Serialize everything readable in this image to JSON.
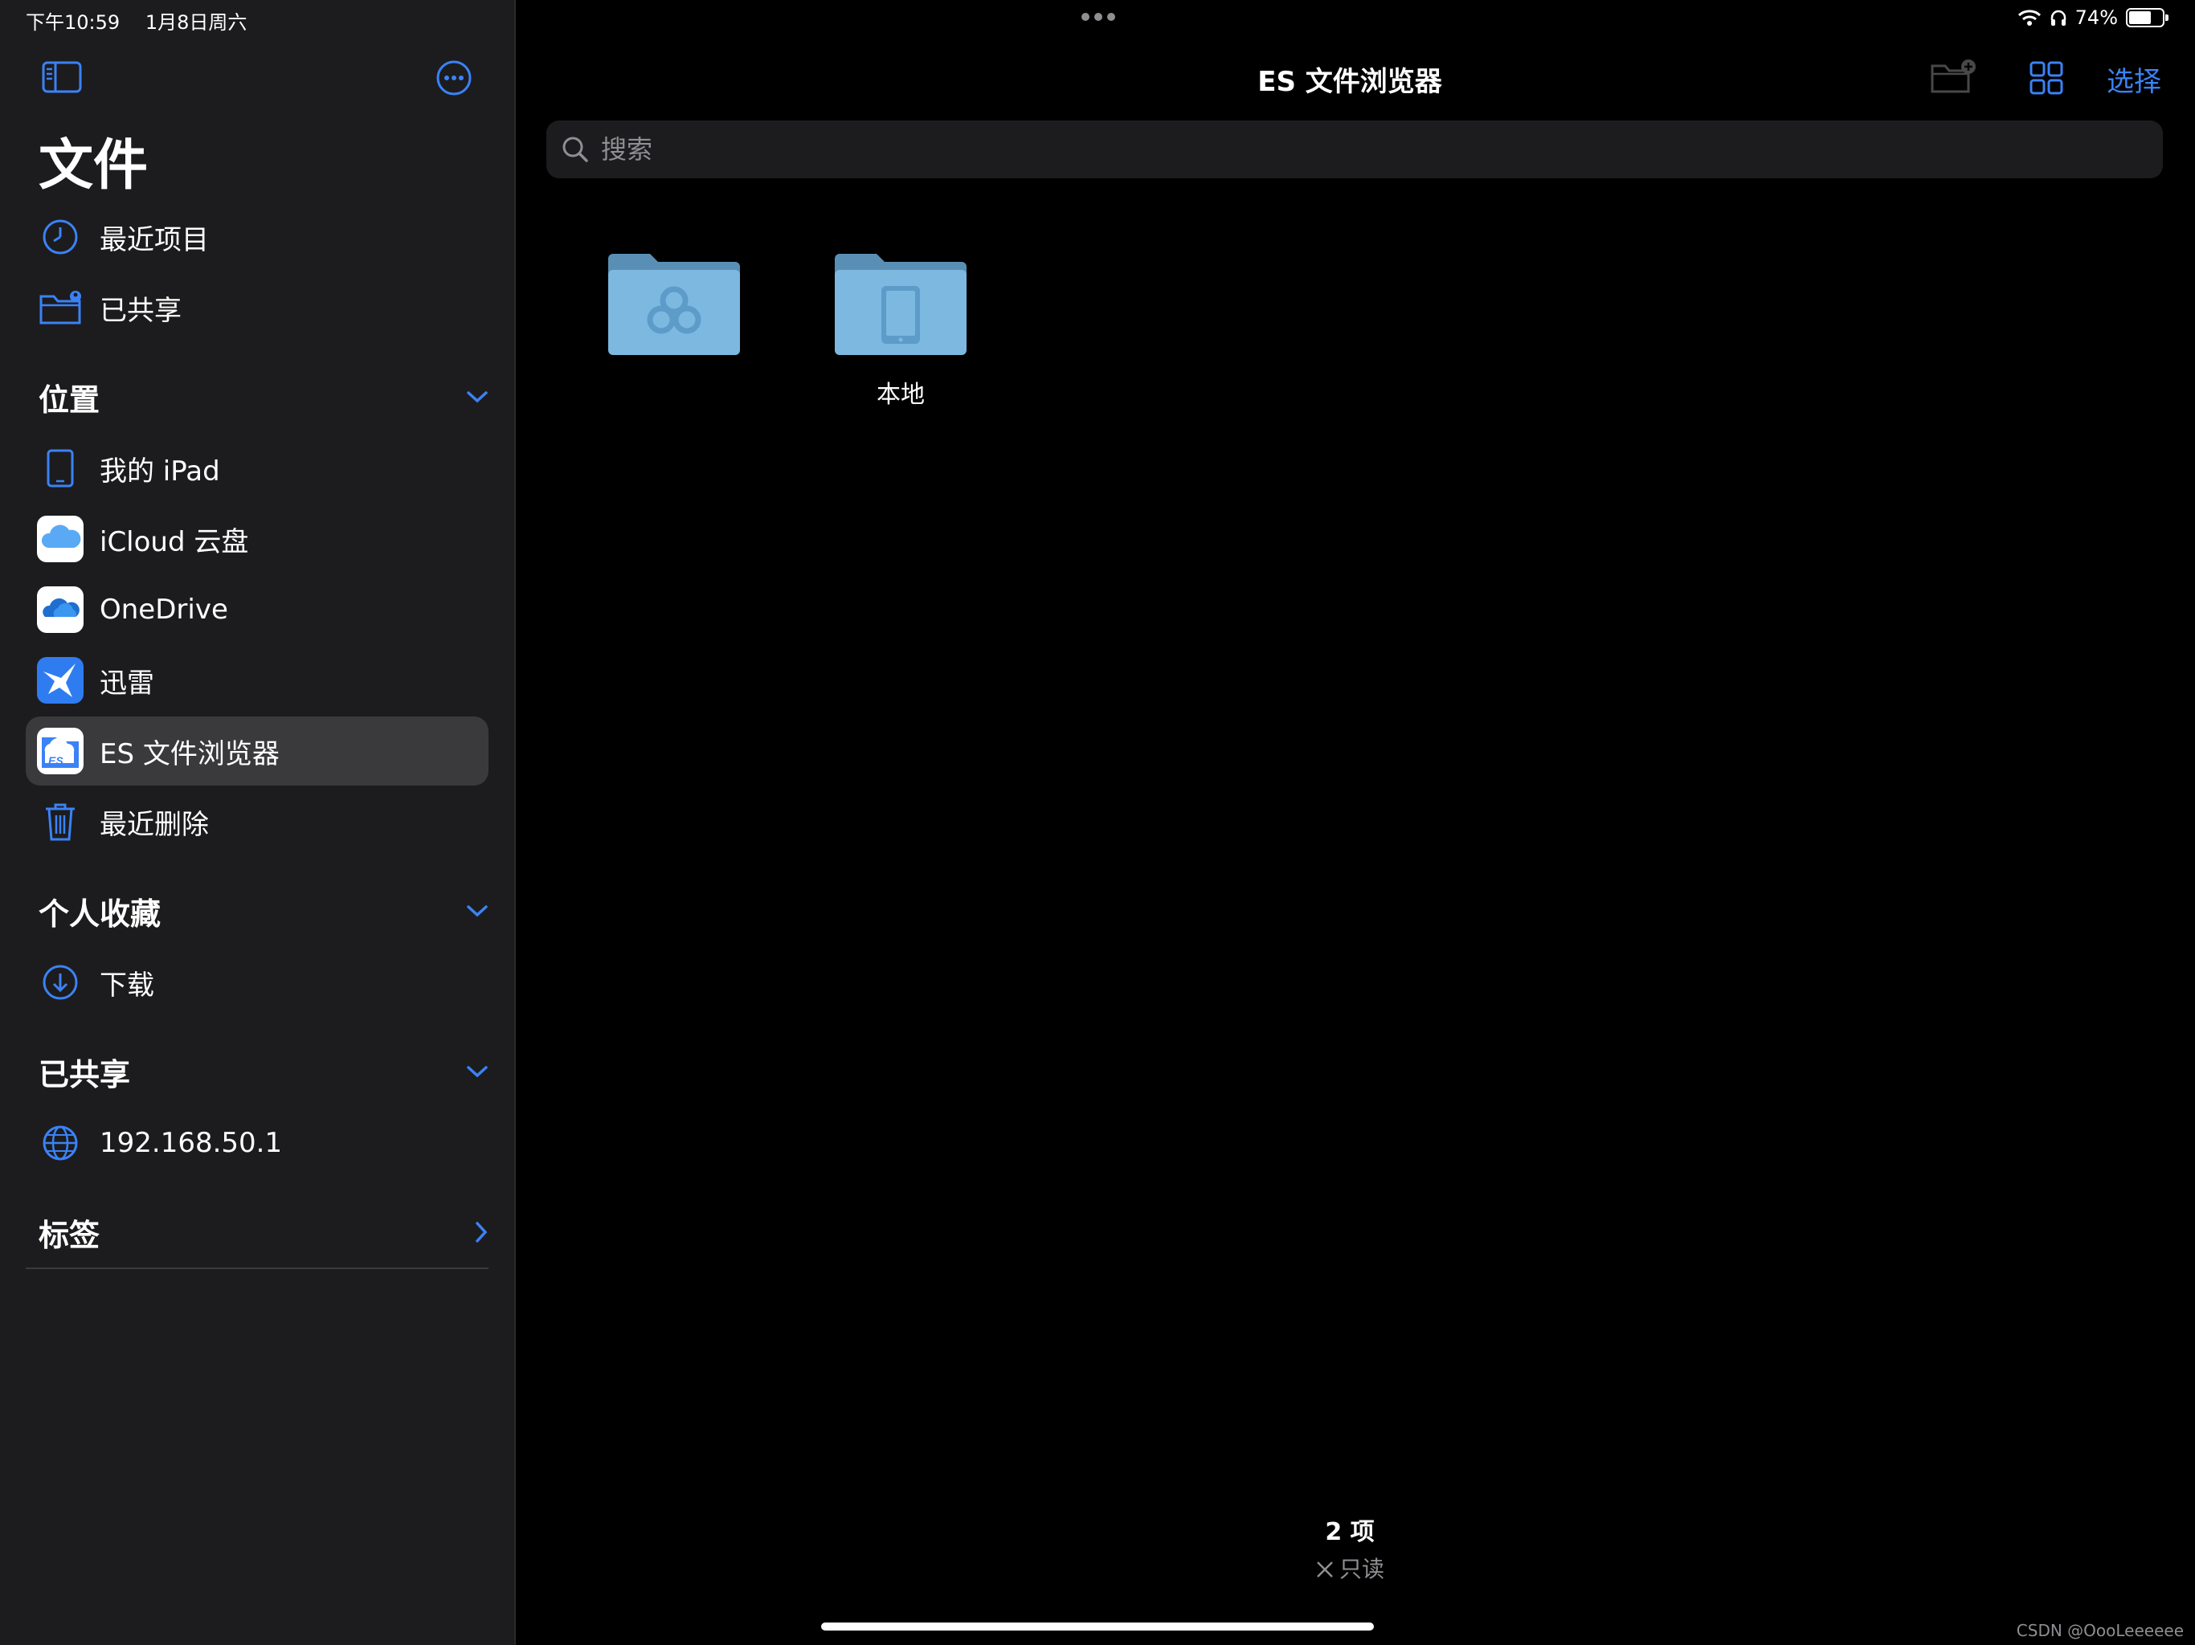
{
  "status": {
    "time": "下午10:59",
    "date": "1月8日周六",
    "battery": "74%",
    "battery_level": 0.74
  },
  "sidebar": {
    "title": "文件",
    "items": [
      {
        "label": "最近项目",
        "icon": "clock-icon"
      },
      {
        "label": "已共享",
        "icon": "shared-folder-icon"
      }
    ],
    "locations": {
      "heading": "位置",
      "items": [
        {
          "label": "我的 iPad",
          "icon": "ipad-icon"
        },
        {
          "label": "iCloud 云盘",
          "icon": "icloud-icon"
        },
        {
          "label": "OneDrive",
          "icon": "onedrive-icon"
        },
        {
          "label": "迅雷",
          "icon": "thunder-icon"
        },
        {
          "label": "ES 文件浏览器",
          "icon": "es-file-explorer-icon",
          "selected": true
        },
        {
          "label": "最近删除",
          "icon": "trash-icon"
        }
      ]
    },
    "favorites": {
      "heading": "个人收藏",
      "items": [
        {
          "label": "下载",
          "icon": "download-icon"
        }
      ]
    },
    "shared": {
      "heading": "已共享",
      "items": [
        {
          "label": "192.168.50.1",
          "icon": "globe-icon"
        }
      ]
    },
    "tags": {
      "heading": "标签"
    }
  },
  "main": {
    "title": "ES 文件浏览器",
    "select_label": "选择",
    "search_placeholder": "搜索",
    "folders": [
      {
        "name": "",
        "icon": "cloud-folder-icon"
      },
      {
        "name": "本地",
        "icon": "device-folder-icon"
      }
    ],
    "item_count": "2 项",
    "read_only": "只读"
  },
  "colors": {
    "accent": "#3b82f6",
    "sidebar_bg": "#1c1c1e",
    "selected_bg": "#3a3a3c",
    "folder": "#7cb8e0"
  },
  "watermark": "CSDN @OooLeeeeee"
}
